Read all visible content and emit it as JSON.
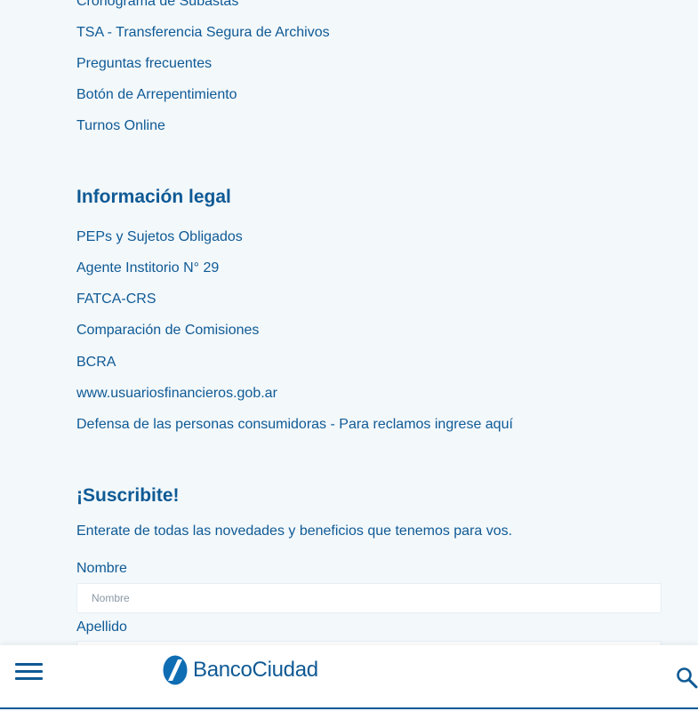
{
  "services_links": [
    "Cronograma de Subastas",
    "TSA - Transferencia Segura de Archivos",
    "Preguntas frecuentes",
    "Botón de Arrepentimiento",
    "Turnos Online"
  ],
  "legal": {
    "heading": "Información legal",
    "links": [
      "PEPs y Sujetos Obligados",
      "Agente Institorio N° 29",
      "FATCA-CRS",
      "Comparación de Comisiones",
      "BCRA",
      "www.usuariosfinancieros.gob.ar",
      "Defensa de las personas consumidoras - Para reclamos ingrese aquí"
    ]
  },
  "subscribe": {
    "heading": "¡Suscribite!",
    "description": "Enterate de todas las novedades y beneficios que tenemos para vos.",
    "nombre_label": "Nombre",
    "nombre_placeholder": "Nombre",
    "apellido_label": "Apellido"
  },
  "bottom_bar": {
    "logo_text": "BancoCiudad",
    "menu_icon": "hamburger-menu-icon",
    "search_icon": "search-icon"
  },
  "colors": {
    "brand_blue": "#0f5a95",
    "background": "#f3f8fb"
  }
}
